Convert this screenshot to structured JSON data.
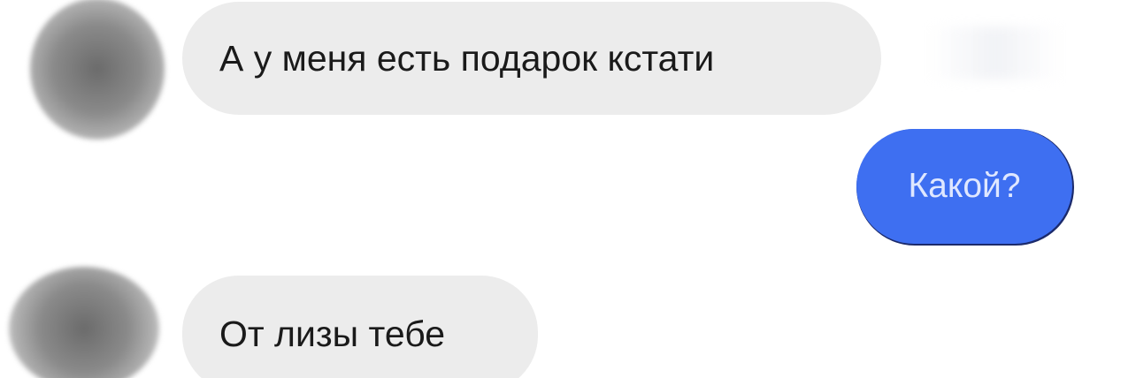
{
  "messages": [
    {
      "from": "contact",
      "text": "А у меня есть подарок кстати"
    },
    {
      "from": "me",
      "text": "Какой?"
    },
    {
      "from": "contact",
      "text": "От лизы тебе"
    }
  ],
  "colors": {
    "incoming_bubble": "#ececec",
    "outgoing_bubble": "#3e6ff1",
    "avatar": "#8a8a8a"
  }
}
